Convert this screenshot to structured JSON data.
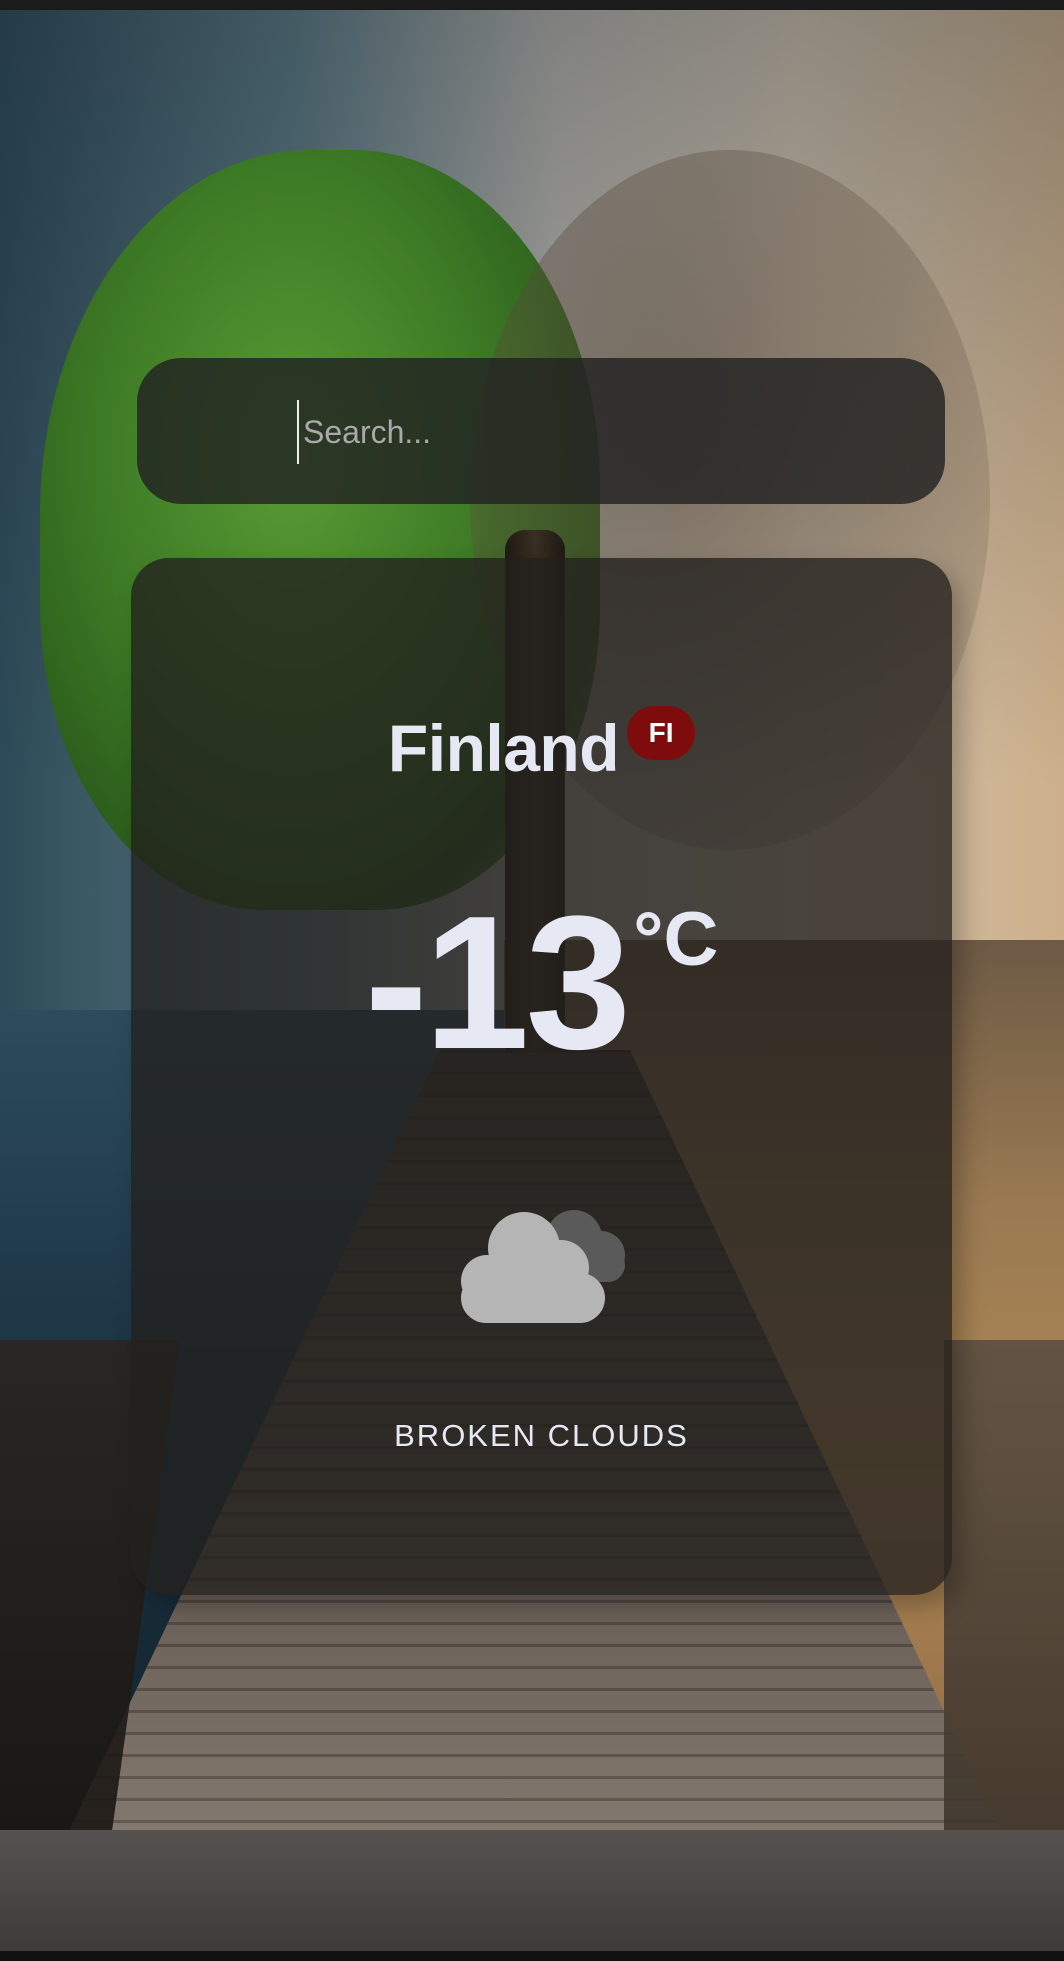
{
  "search": {
    "placeholder": "Search...",
    "value": ""
  },
  "weather": {
    "city": "Finland",
    "country_code": "FI",
    "temperature": "-13",
    "unit": "°C",
    "description": "BROKEN CLOUDS",
    "icon": "broken-clouds-icon"
  },
  "colors": {
    "badge": "#7e0c0c",
    "card_text": "#e6e8f3",
    "panel_bg": "#222222"
  }
}
